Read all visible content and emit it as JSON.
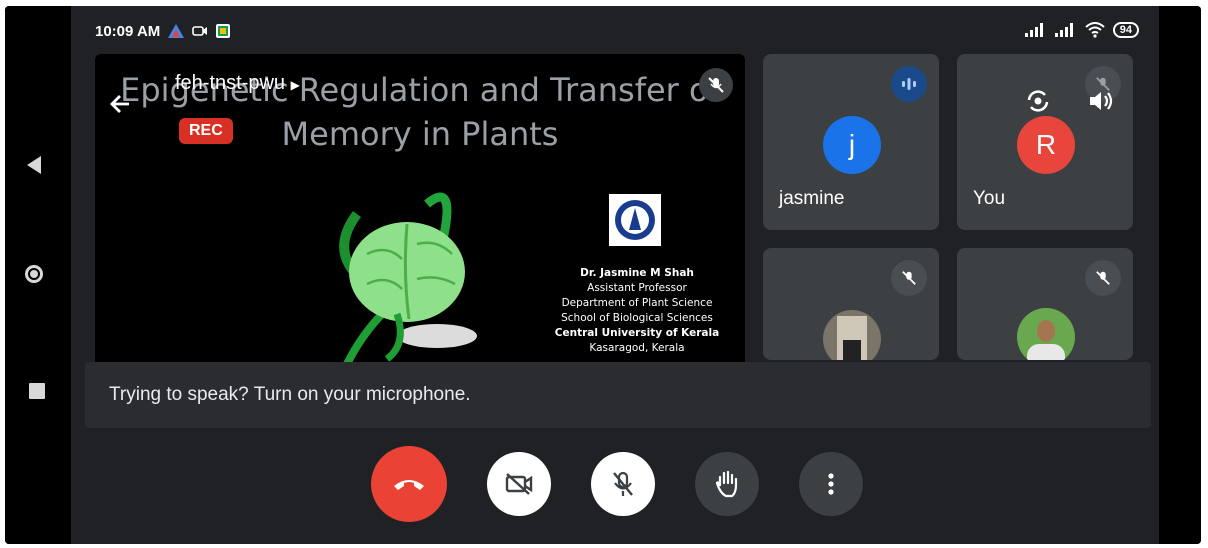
{
  "status_bar": {
    "time": "10:09 AM",
    "battery": "94"
  },
  "meeting": {
    "code": "feh-tnst-pwu",
    "rec_label": "REC"
  },
  "slide": {
    "title_line1": "Epigenetic Regulation and Transfer of",
    "title_line2": "Memory in Plants",
    "author_name": "Dr. Jasmine M Shah",
    "author_role": "Assistant Professor",
    "department": "Department of Plant Science",
    "school": "School of Biological Sciences",
    "university": "Central University of Kerala",
    "location": "Kasaragod, Kerala"
  },
  "participants": [
    {
      "name": "jasmine",
      "initial": "j",
      "avatar_color": "#1a73e8",
      "speaking": true
    },
    {
      "name": "You",
      "initial": "R",
      "avatar_color": "#e8453c",
      "muted": true
    }
  ],
  "caption": "Trying to speak? Turn on your microphone.",
  "controls": [
    "end-call",
    "camera-off",
    "mic-off",
    "raise-hand",
    "more-options"
  ],
  "colors": {
    "background": "#202124",
    "tile": "#3c4043",
    "end_call": "#ea4335"
  }
}
